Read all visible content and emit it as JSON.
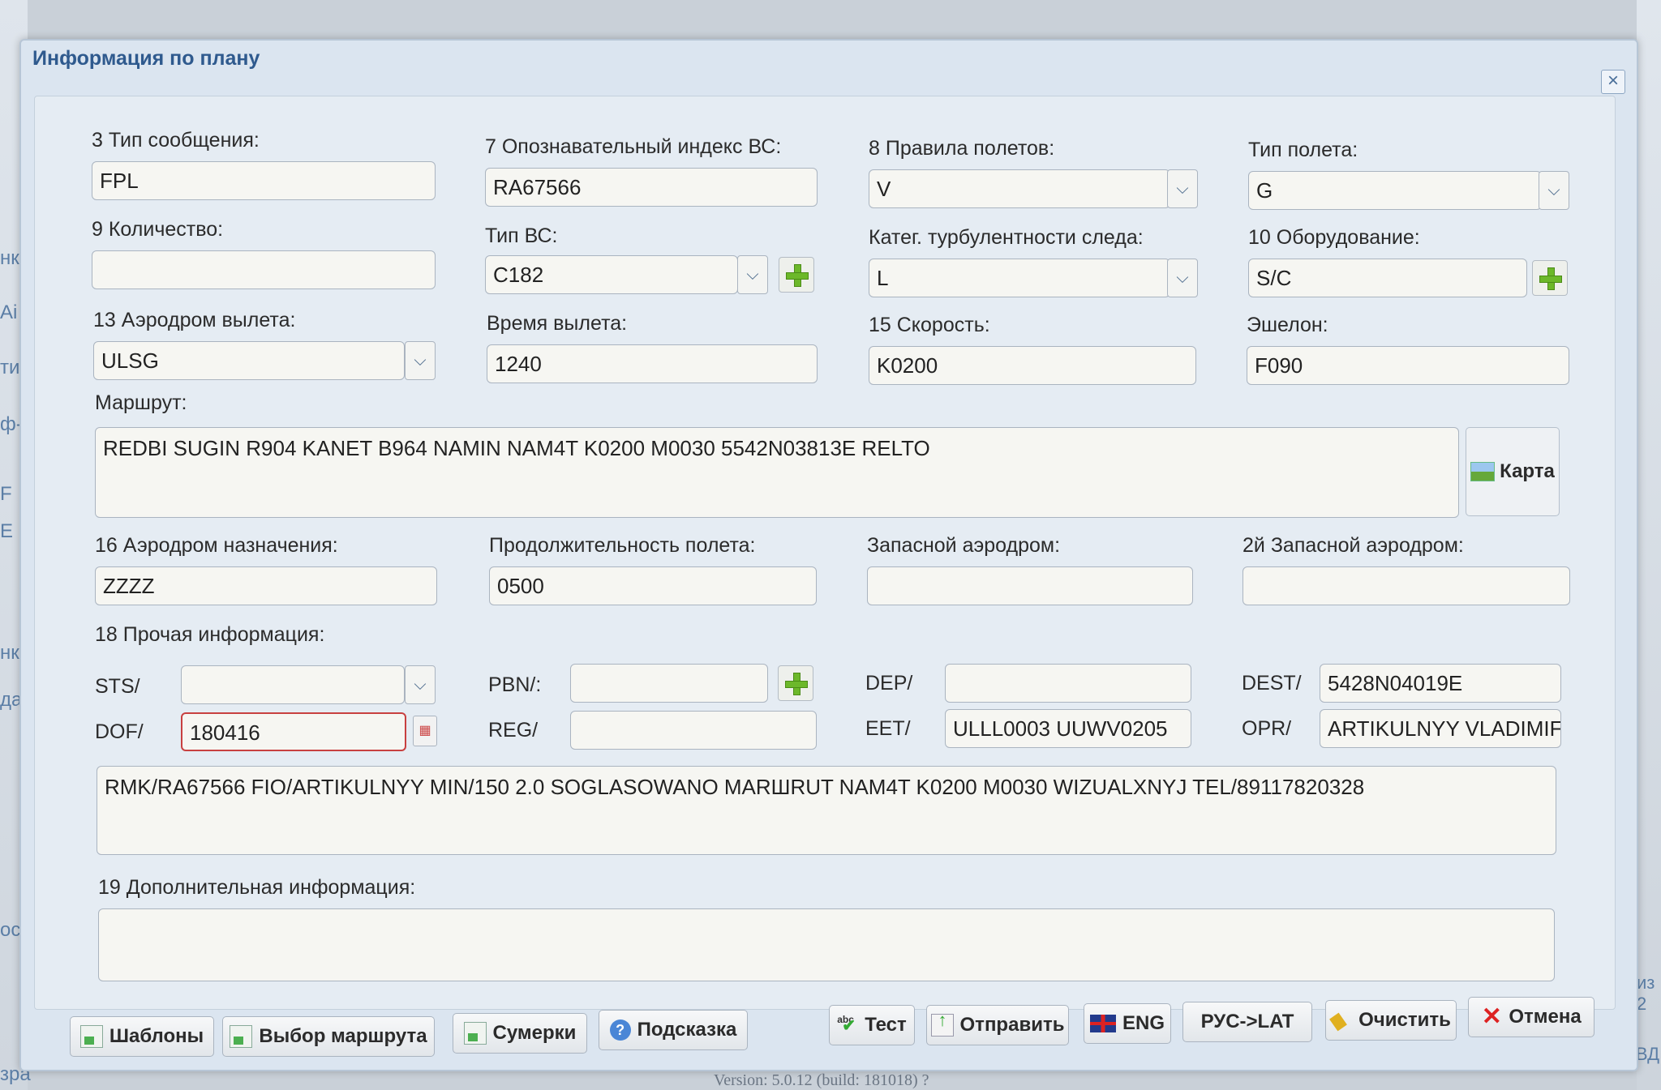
{
  "window": {
    "title": "Информация по плану"
  },
  "version": "Version: 5.0.12 (build: 181018) ?",
  "background": {
    "left_fragments": [
      "нк",
      "Ai",
      "ти",
      "ф-",
      "F",
      "E",
      "нк",
      "да",
      "ос",
      "зра"
    ],
    "right_fragments": [
      "из 2",
      "рВД"
    ]
  },
  "fields": {
    "msg_type": {
      "label": "3 Тип сообщения:",
      "value": "FPL"
    },
    "callsign": {
      "label": "7 Опознавательный индекс ВС:",
      "value": "RA67566"
    },
    "flight_rules": {
      "label": "8 Правила полетов:",
      "value": "V"
    },
    "flight_type": {
      "label": "Тип полета:",
      "value": "G"
    },
    "count": {
      "label": "9 Количество:",
      "value": ""
    },
    "aircraft_type": {
      "label": "Тип ВС:",
      "value": "C182"
    },
    "wake_cat": {
      "label": "Катег. турбулентности следа:",
      "value": "L"
    },
    "equipment": {
      "label": "10 Оборудование:",
      "value": "S/C"
    },
    "dep_aerodrome": {
      "label": "13 Аэродром вылета:",
      "value": "ULSG"
    },
    "dep_time": {
      "label": "Время вылета:",
      "value": "1240"
    },
    "speed": {
      "label": "15 Скорость:",
      "value": "K0200"
    },
    "level": {
      "label": "Эшелон:",
      "value": "F090"
    },
    "route": {
      "label": "Маршрут:",
      "value": "REDBI SUGIN R904 KANET B964 NAMIN NAM4T K0200 M0030 5542N03813E RELTO"
    },
    "dest_aerodrome": {
      "label": "16 Аэродром назначения:",
      "value": "ZZZZ"
    },
    "duration": {
      "label": "Продолжительность полета:",
      "value": "0500"
    },
    "alt_aerodrome": {
      "label": "Запасной аэродром:",
      "value": ""
    },
    "alt2_aerodrome": {
      "label": "2й Запасной аэродром:",
      "value": ""
    },
    "other_info": {
      "label": "18 Прочая информация:"
    },
    "sts": {
      "label": "STS/",
      "value": ""
    },
    "pbn": {
      "label": "PBN/:",
      "value": ""
    },
    "dep": {
      "label": "DEP/",
      "value": ""
    },
    "dest": {
      "label": "DEST/",
      "value": "5428N04019E"
    },
    "dof": {
      "label": "DOF/",
      "value": "180416"
    },
    "reg": {
      "label": "REG/",
      "value": ""
    },
    "eet": {
      "label": "EET/",
      "value": "ULLL0003 UUWV0205"
    },
    "opr": {
      "label": "OPR/",
      "value": "ARTIKULNYY VLADIMIF"
    },
    "rmk": {
      "value": "RMK/RA67566 FIO/ARTIKULNYY MIN/150 2.0 SOGLASOWANO MARШRUT NAM4T K0200 M0030 WIZUALXNYJ TEL/89117820328"
    },
    "extra_info": {
      "label": "19 Дополнительная информация:",
      "value": ""
    }
  },
  "map_button": "Карта",
  "buttons": {
    "templates": "Шаблоны",
    "route_select": "Выбор маршрута",
    "twilight": "Сумерки",
    "hint": "Подсказка",
    "test": "Тест",
    "send": "Отправить",
    "eng": "ENG",
    "rus_lat": "РУС->LAT",
    "clear": "Очистить",
    "cancel": "Отмена"
  },
  "icons": {
    "abc_label": "abc"
  }
}
